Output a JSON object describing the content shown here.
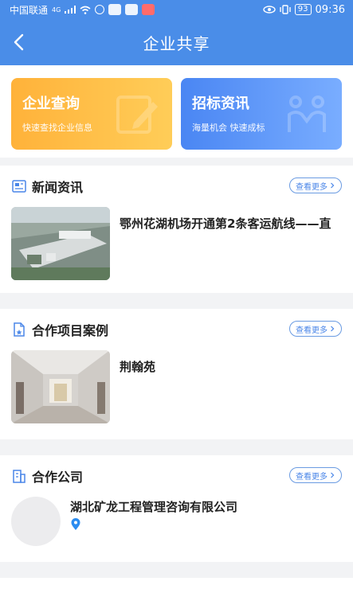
{
  "status_bar": {
    "carrier": "中国联通",
    "signal_text": "4G",
    "battery": "93",
    "time": "09:36"
  },
  "header": {
    "title": "企业共享"
  },
  "cards": [
    {
      "title": "企业查询",
      "subtitle": "快速查找企业信息"
    },
    {
      "title": "招标资讯",
      "subtitle": "海量机会 快速成标"
    }
  ],
  "sections": {
    "news": {
      "title": "新闻资讯",
      "more_label": "查看更多",
      "item_title": "鄂州花湖机场开通第2条客运航线——直"
    },
    "projects": {
      "title": "合作项目案例",
      "more_label": "查看更多",
      "item_title": "荆翰苑"
    },
    "companies": {
      "title": "合作公司",
      "more_label": "查看更多",
      "item_title": "湖北矿龙工程管理咨询有限公司"
    }
  },
  "colors": {
    "primary": "#4a8de8",
    "orange_card": "#ffb23a",
    "blue_card": "#4a86f3",
    "more_border": "#6a9be2"
  },
  "icons": [
    "back-arrow-icon",
    "news-icon",
    "project-icon",
    "building-icon",
    "location-pin-icon",
    "chevron-right-icon"
  ]
}
